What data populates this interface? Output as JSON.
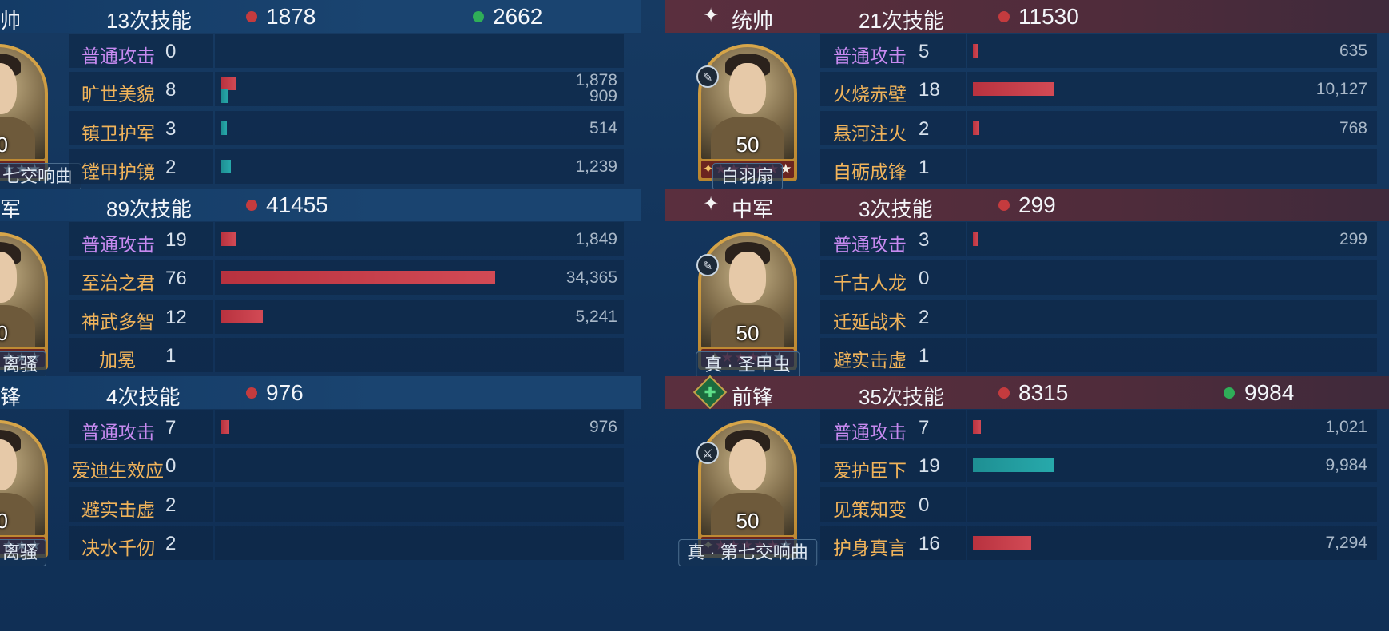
{
  "left_team": {
    "sections": [
      {
        "role": "帅",
        "skill_count": "13次技能",
        "damage": "1878",
        "heal": "2662",
        "portrait": {
          "level": "0",
          "stars": "★★★"
        },
        "tag": "七交响曲",
        "rows": [
          {
            "skill": "普通攻击",
            "count": "0",
            "kind": "basic",
            "value": ""
          },
          {
            "skill": "旷世美貌",
            "count": "8",
            "kind": "skill",
            "value": "1,878",
            "value2": "909",
            "bar_red": 1878,
            "bar_teal": 909
          },
          {
            "skill": "镇卫护军",
            "count": "3",
            "kind": "skill",
            "value": "514",
            "bar_teal": 514
          },
          {
            "skill": "镗甲护镜",
            "count": "2",
            "kind": "skill",
            "value": "1,239",
            "bar_teal": 1239
          }
        ]
      },
      {
        "role": "军",
        "skill_count": "89次技能",
        "damage": "41455",
        "heal": "",
        "portrait": {
          "level": "0",
          "stars": "★★★"
        },
        "tag": "离骚",
        "rows": [
          {
            "skill": "普通攻击",
            "count": "19",
            "kind": "basic",
            "value": "1,849",
            "bar_red": 1849
          },
          {
            "skill": "至治之君",
            "count": "76",
            "kind": "skill",
            "value": "34,365",
            "bar_red": 34365
          },
          {
            "skill": "神武多智",
            "count": "12",
            "kind": "skill",
            "value": "5,241",
            "bar_red": 5241
          },
          {
            "skill": "加冕",
            "count": "1",
            "kind": "skill",
            "value": ""
          }
        ]
      },
      {
        "role": "锋",
        "skill_count": "4次技能",
        "damage": "976",
        "heal": "",
        "portrait": {
          "level": "0",
          "stars": "★★★"
        },
        "tag": "离骚",
        "rows": [
          {
            "skill": "普通攻击",
            "count": "7",
            "kind": "basic",
            "value": "976",
            "bar_red": 976
          },
          {
            "skill": "爱迪生效应",
            "count": "0",
            "kind": "skill",
            "value": ""
          },
          {
            "skill": "避实击虚",
            "count": "2",
            "kind": "skill",
            "value": ""
          },
          {
            "skill": "决水千仞",
            "count": "2",
            "kind": "skill",
            "value": ""
          }
        ]
      }
    ]
  },
  "right_team": {
    "sections": [
      {
        "role": "统帅",
        "role_icon": "sparkle-icon",
        "skill_count": "21次技能",
        "damage": "11530",
        "heal": "",
        "portrait": {
          "level": "50",
          "stars_lead": "✦",
          "stars_red": "★★★★★",
          "stars_white": "★"
        },
        "badge": "✎",
        "tag": "白羽扇",
        "rows": [
          {
            "skill": "普通攻击",
            "count": "5",
            "kind": "basic",
            "value": "635",
            "bar_red": 635
          },
          {
            "skill": "火烧赤壁",
            "count": "18",
            "kind": "skill",
            "value": "10,127",
            "bar_red": 10127
          },
          {
            "skill": "悬河注火",
            "count": "2",
            "kind": "skill",
            "value": "768",
            "bar_red": 768
          },
          {
            "skill": "自砺成锋",
            "count": "1",
            "kind": "skill",
            "value": ""
          }
        ]
      },
      {
        "role": "中军",
        "role_icon": "sparkle-icon",
        "skill_count": "3次技能",
        "damage": "299",
        "heal": "",
        "portrait": {
          "level": "50",
          "stars_lead": "✦",
          "stars_red": "★★★",
          "stars_white": "★★"
        },
        "badge": "✎",
        "tag": "真 · 圣甲虫",
        "rows": [
          {
            "skill": "普通攻击",
            "count": "3",
            "kind": "basic",
            "value": "299",
            "bar_red": 299
          },
          {
            "skill": "千古人龙",
            "count": "0",
            "kind": "skill",
            "value": ""
          },
          {
            "skill": "迁延战术",
            "count": "2",
            "kind": "skill",
            "value": ""
          },
          {
            "skill": "避实击虚",
            "count": "1",
            "kind": "skill",
            "value": ""
          }
        ]
      },
      {
        "role": "前锋",
        "role_icon": "heart-plus-icon",
        "skill_count": "35次技能",
        "damage": "8315",
        "heal": "9984",
        "portrait": {
          "level": "50",
          "stars_lead": "✦",
          "stars_red": "★★★★★",
          "stars_white": "★"
        },
        "badge": "⚔",
        "tag": "真 · 第七交响曲",
        "rows": [
          {
            "skill": "普通攻击",
            "count": "7",
            "kind": "basic",
            "value": "1,021",
            "bar_red": 1021
          },
          {
            "skill": "爱护臣下",
            "count": "19",
            "kind": "skill",
            "value": "9,984",
            "bar_teal": 9984
          },
          {
            "skill": "见策知变",
            "count": "0",
            "kind": "skill",
            "value": ""
          },
          {
            "skill": "护身真言",
            "count": "16",
            "kind": "skill",
            "value": "7,294",
            "bar_red": 7294
          }
        ]
      }
    ]
  }
}
